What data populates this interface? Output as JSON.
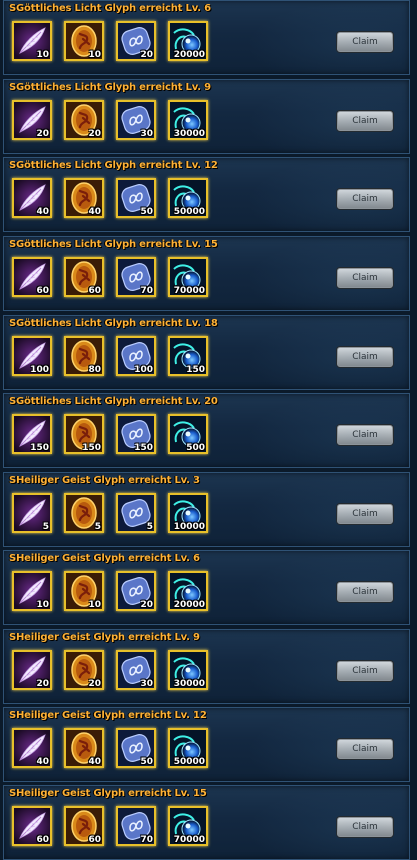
{
  "claim_label": "Claim",
  "rows": [
    {
      "title": "SGöttliches Licht Glyph erreicht Lv. 6",
      "quantities": [
        "10",
        "10",
        "20",
        "20000"
      ]
    },
    {
      "title": "SGöttliches Licht Glyph erreicht Lv. 9",
      "quantities": [
        "20",
        "20",
        "30",
        "30000"
      ]
    },
    {
      "title": "SGöttliches Licht Glyph erreicht Lv. 12",
      "quantities": [
        "40",
        "40",
        "50",
        "50000"
      ]
    },
    {
      "title": "SGöttliches Licht Glyph erreicht Lv. 15",
      "quantities": [
        "60",
        "60",
        "70",
        "70000"
      ]
    },
    {
      "title": "SGöttliches Licht Glyph erreicht Lv. 18",
      "quantities": [
        "100",
        "80",
        "100",
        "150"
      ]
    },
    {
      "title": "SGöttliches Licht Glyph erreicht Lv. 20",
      "quantities": [
        "150",
        "150",
        "150",
        "500"
      ]
    },
    {
      "title": "SHeiliger Geist Glyph erreicht Lv. 3",
      "quantities": [
        "5",
        "5",
        "5",
        "10000"
      ]
    },
    {
      "title": "SHeiliger Geist Glyph erreicht Lv. 6",
      "quantities": [
        "10",
        "10",
        "20",
        "20000"
      ]
    },
    {
      "title": "SHeiliger Geist Glyph erreicht Lv. 9",
      "quantities": [
        "20",
        "20",
        "30",
        "30000"
      ]
    },
    {
      "title": "SHeiliger Geist Glyph erreicht Lv. 12",
      "quantities": [
        "40",
        "40",
        "50",
        "50000"
      ]
    },
    {
      "title": "SHeiliger Geist Glyph erreicht Lv. 15",
      "quantities": [
        "60",
        "60",
        "70",
        "70000"
      ]
    }
  ],
  "items": [
    {
      "icon": "feather-icon"
    },
    {
      "icon": "golden-egg-emblem-icon"
    },
    {
      "icon": "blue-rune-stone-icon"
    },
    {
      "icon": "blue-energy-orb-icon"
    }
  ],
  "colors": {
    "title": "#ffb236",
    "item_border": "#e8c02a",
    "row_background": "#132841",
    "button": "#b9b9b9"
  }
}
